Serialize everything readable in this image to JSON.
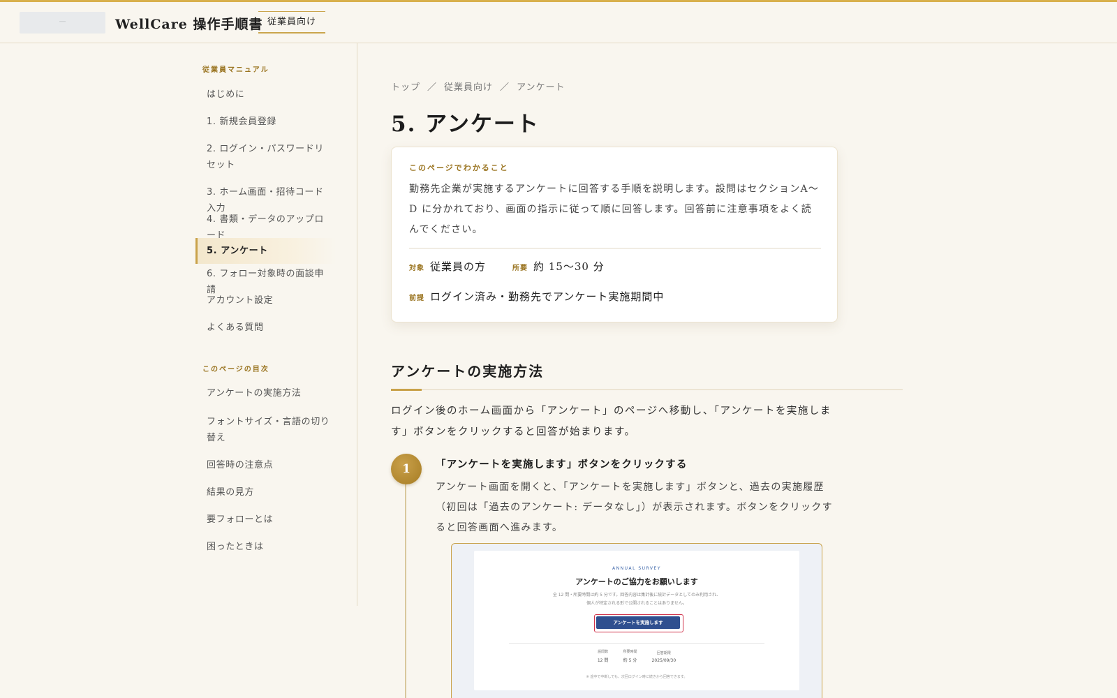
{
  "header": {
    "logo_text": "―",
    "site_title": "WellCare 操作手順書",
    "audience_tab": "従業員向け"
  },
  "sidebar": {
    "manual_heading": "従業員マニュアル",
    "manual_items": [
      {
        "label": "はじめに"
      },
      {
        "label": "1. 新規会員登録"
      },
      {
        "label": "2. ログイン・パスワードリセット"
      },
      {
        "label": "3. ホーム画面・招待コード入力"
      },
      {
        "label": "4. 書類・データのアップロード"
      },
      {
        "label": "5. アンケート",
        "active": true
      },
      {
        "label": "6. フォロー対象時の面談申請"
      },
      {
        "label": "アカウント設定"
      },
      {
        "label": "よくある質問"
      }
    ],
    "toc_heading": "このページの目次",
    "toc_items": [
      {
        "label": "アンケートの実施方法"
      },
      {
        "label": "フォントサイズ・言語の切り替え"
      },
      {
        "label": "回答時の注意点"
      },
      {
        "label": "結果の見方"
      },
      {
        "label": "要フォローとは"
      },
      {
        "label": "困ったときは"
      }
    ]
  },
  "breadcrumb": {
    "items": [
      "トップ",
      "従業員向け",
      "アンケート"
    ],
    "separator": "／"
  },
  "page": {
    "title": "5. アンケート"
  },
  "summary": {
    "label": "このページでわかること",
    "description": "勤務先企業が実施するアンケートに回答する手順を説明します。設問はセクションA〜D に分かれており、画面の指示に従って順に回答します。回答前に注意事項をよく読んでください。",
    "target_key": "対象",
    "target_value": "従業員の方",
    "duration_key": "所要",
    "duration_value": "約 15〜30 分",
    "prereq_key": "前提",
    "prereq_value": "ログイン済み・勤務先でアンケート実施期間中"
  },
  "section": {
    "title": "アンケートの実施方法",
    "intro": "ログイン後のホーム画面から「アンケート」のページへ移動し、「アンケートを実施します」ボタンをクリックすると回答が始まります。"
  },
  "step1": {
    "number": "1",
    "title": "「アンケートを実施します」ボタンをクリックする",
    "description": "アンケート画面を開くと、「アンケートを実施します」ボタンと、過去の実施履歴（初回は「過去のアンケート: データなし」）が表示されます。ボタンをクリックすると回答画面へ進みます。"
  },
  "screenshot": {
    "kicker": "ANNUAL SURVEY",
    "heading": "アンケートのご協力をお願いします",
    "note_line1": "全 12 問・所要時間は約 5 分です。回答内容は集計後に統計データとしてのみ利用され、",
    "note_line2": "個人が特定される形で公開されることはありません。",
    "button_label": "アンケートを実施します",
    "stats": [
      {
        "key": "設問数",
        "value": "12 問"
      },
      {
        "key": "所要時間",
        "value": "約 5 分"
      },
      {
        "key": "回答期限",
        "value": "2025/09/30"
      }
    ],
    "footnote": "※ 途中で中断しても、次回ログイン時に続きから回答できます。"
  },
  "colors": {
    "accent_gold": "#c9a24a",
    "background": "#f9f6ef",
    "button_blue": "#2f4f8f",
    "highlight_red": "#d0324a"
  }
}
